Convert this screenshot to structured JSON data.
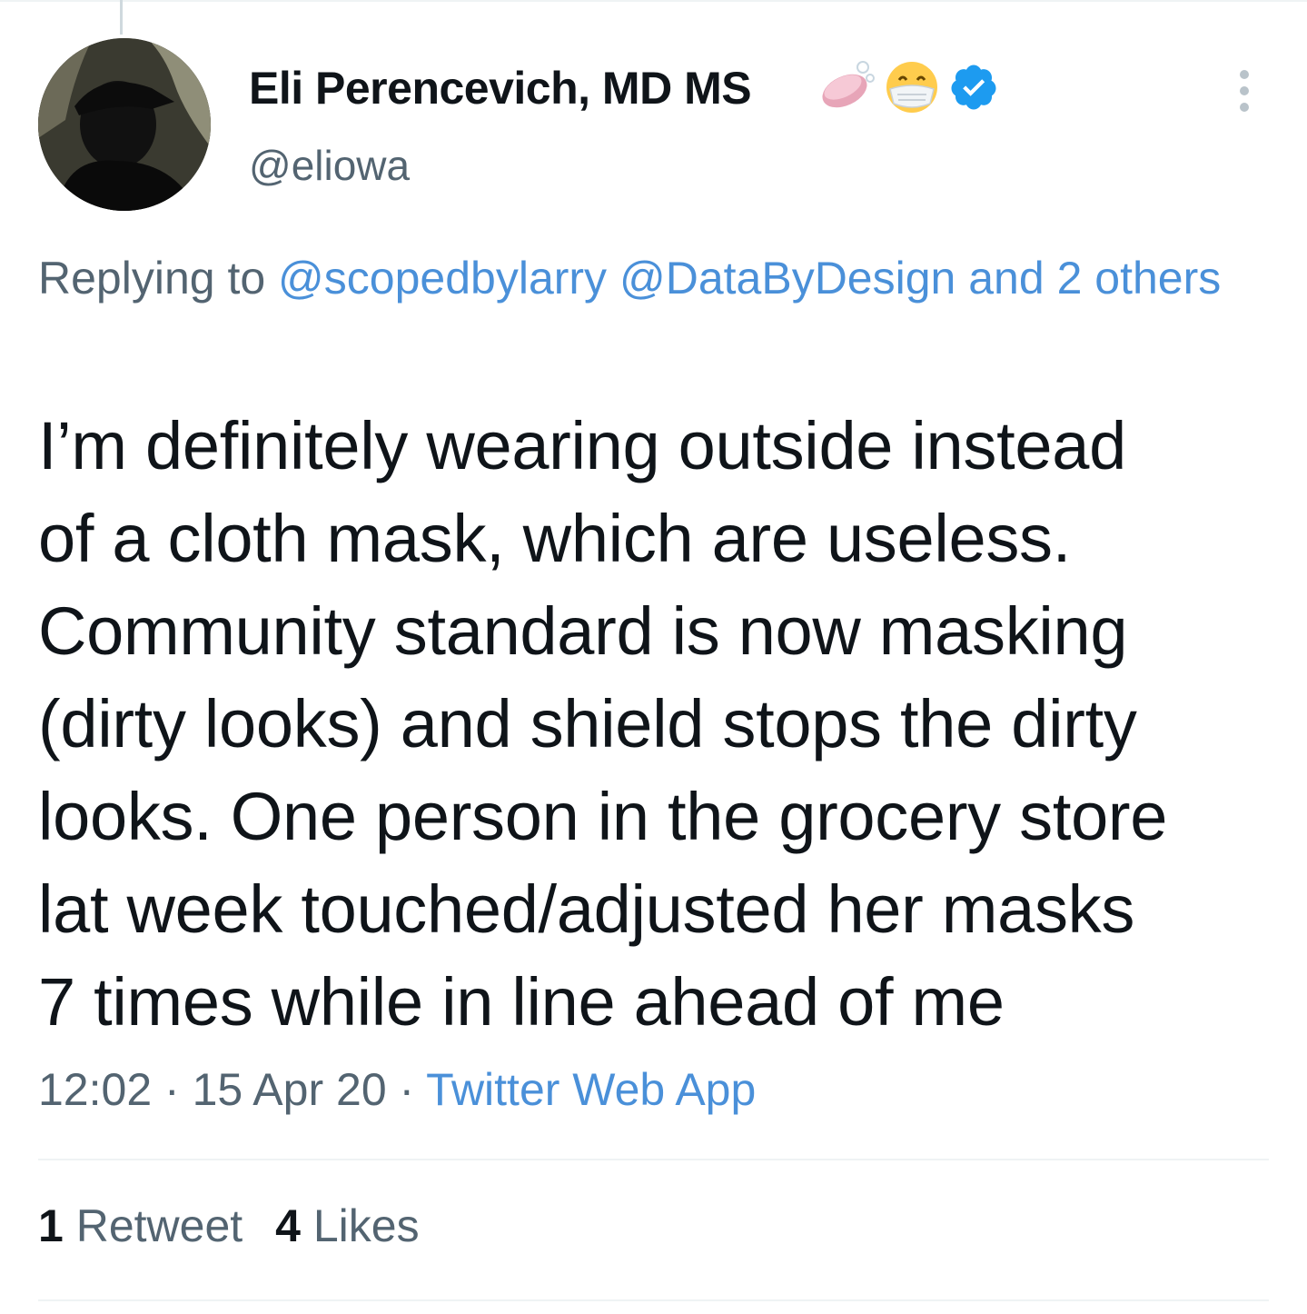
{
  "tweet": {
    "author_name": "Eli Perencevich, MD MS",
    "name_icons": [
      "soap-emoji-icon",
      "face-with-medical-mask-emoji-icon",
      "verified-badge-icon"
    ],
    "handle": "@eliowa",
    "reply_prefix": "Replying to ",
    "reply_mention_1": "@scopedbylarry",
    "reply_mention_2": "@DataByDesign",
    "reply_others": "and 2 others",
    "text": "I’m definitely wearing outside instead\nof a cloth mask, which are useless.\nCommunity standard is now masking\n(dirty looks) and shield stops the dirty\nlooks. One person in the grocery store\nlat week touched/adjusted her masks\n7 times while in line ahead of me",
    "time": "12:02",
    "separator": " · ",
    "date": "15 Apr 20",
    "source": "Twitter Web App",
    "retweet_count": "1",
    "retweet_label": "Retweet",
    "like_count": "4",
    "like_label": "Likes"
  },
  "colors": {
    "text": "#0f1419",
    "secondary": "#536471",
    "link": "#4a90d9",
    "verified": "#1d9bf0",
    "divider": "#eff3f4"
  }
}
